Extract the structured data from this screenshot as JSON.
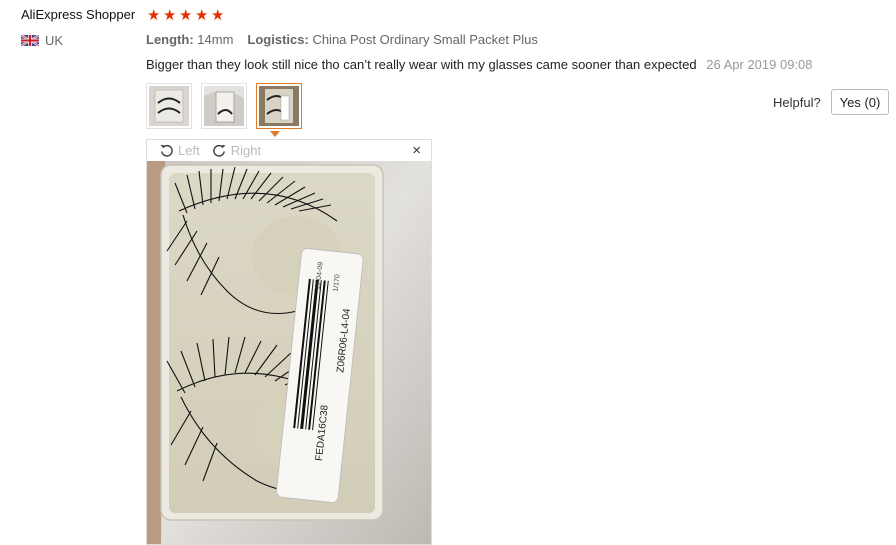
{
  "review": {
    "reviewer": "AliExpress Shopper",
    "rating": 5,
    "country": "UK",
    "length_label": "Length:",
    "length_value": "14mm",
    "logistics_label": "Logistics:",
    "logistics_value": "China Post Ordinary Small Packet Plus",
    "text": "Bigger than they look still nice tho can’t really wear with my glasses came sooner than expected",
    "date": "26 Apr 2019 09:08",
    "helpful_label": "Helpful?",
    "yes_button": "Yes (0)"
  },
  "thumbnails": [
    {
      "name": "thumbnail-1",
      "selected": false
    },
    {
      "name": "thumbnail-2",
      "selected": false
    },
    {
      "name": "thumbnail-3",
      "selected": true
    }
  ],
  "viewer": {
    "rotate_left": "Left",
    "rotate_right": "Right",
    "close": "×",
    "label_lines": [
      "FEDA16C38",
      "Z06R06-L4-04",
      "19-04-09",
      "1/170"
    ]
  },
  "colors": {
    "star": "#e62e04",
    "selected_border": "#e07b29"
  },
  "icons": {
    "flag": "uk-flag-icon",
    "rotate_left": "rotate-left-icon",
    "rotate_right": "rotate-right-icon",
    "close": "close-icon"
  }
}
